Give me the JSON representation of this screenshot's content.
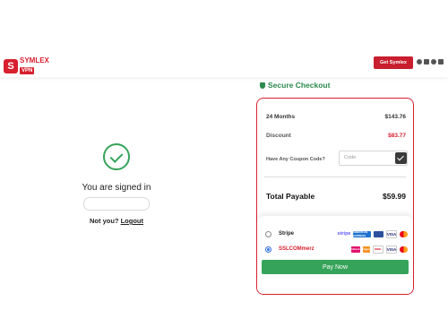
{
  "header": {
    "logo_brand": "SYMLEX",
    "logo_sub": "VPN",
    "cta_label": "Get Symlex",
    "socials": [
      "github-icon",
      "youtube-icon",
      "twitter-icon",
      "instagram-icon"
    ]
  },
  "signin": {
    "title": "You are signed in",
    "notyou_text": "Not you?",
    "logout_label": "Logout"
  },
  "checkout": {
    "title": "Secure Checkout",
    "plan_label": "24 Months",
    "plan_price": "$143.76",
    "discount_label": "Discount",
    "discount_value": "$83.77",
    "coupon_label": "Have Any Coupon Code?",
    "coupon_placeholder": "Code",
    "total_label": "Total Payable",
    "total_value": "$59.99",
    "payment_options": [
      {
        "name": "Stripe",
        "selected": false,
        "logos": [
          "stripe",
          "AMERICAN EXPRESS",
          "VISA",
          "mastercard"
        ]
      },
      {
        "name": "SSLCOMmerz",
        "selected": true,
        "logos": [
          "bKash",
          "Nagad",
          "DBBL",
          "VISA",
          "mastercard"
        ]
      }
    ],
    "pay_label": "Pay Now",
    "colors": {
      "accent": "#d8202f",
      "green": "#35a35a"
    }
  }
}
